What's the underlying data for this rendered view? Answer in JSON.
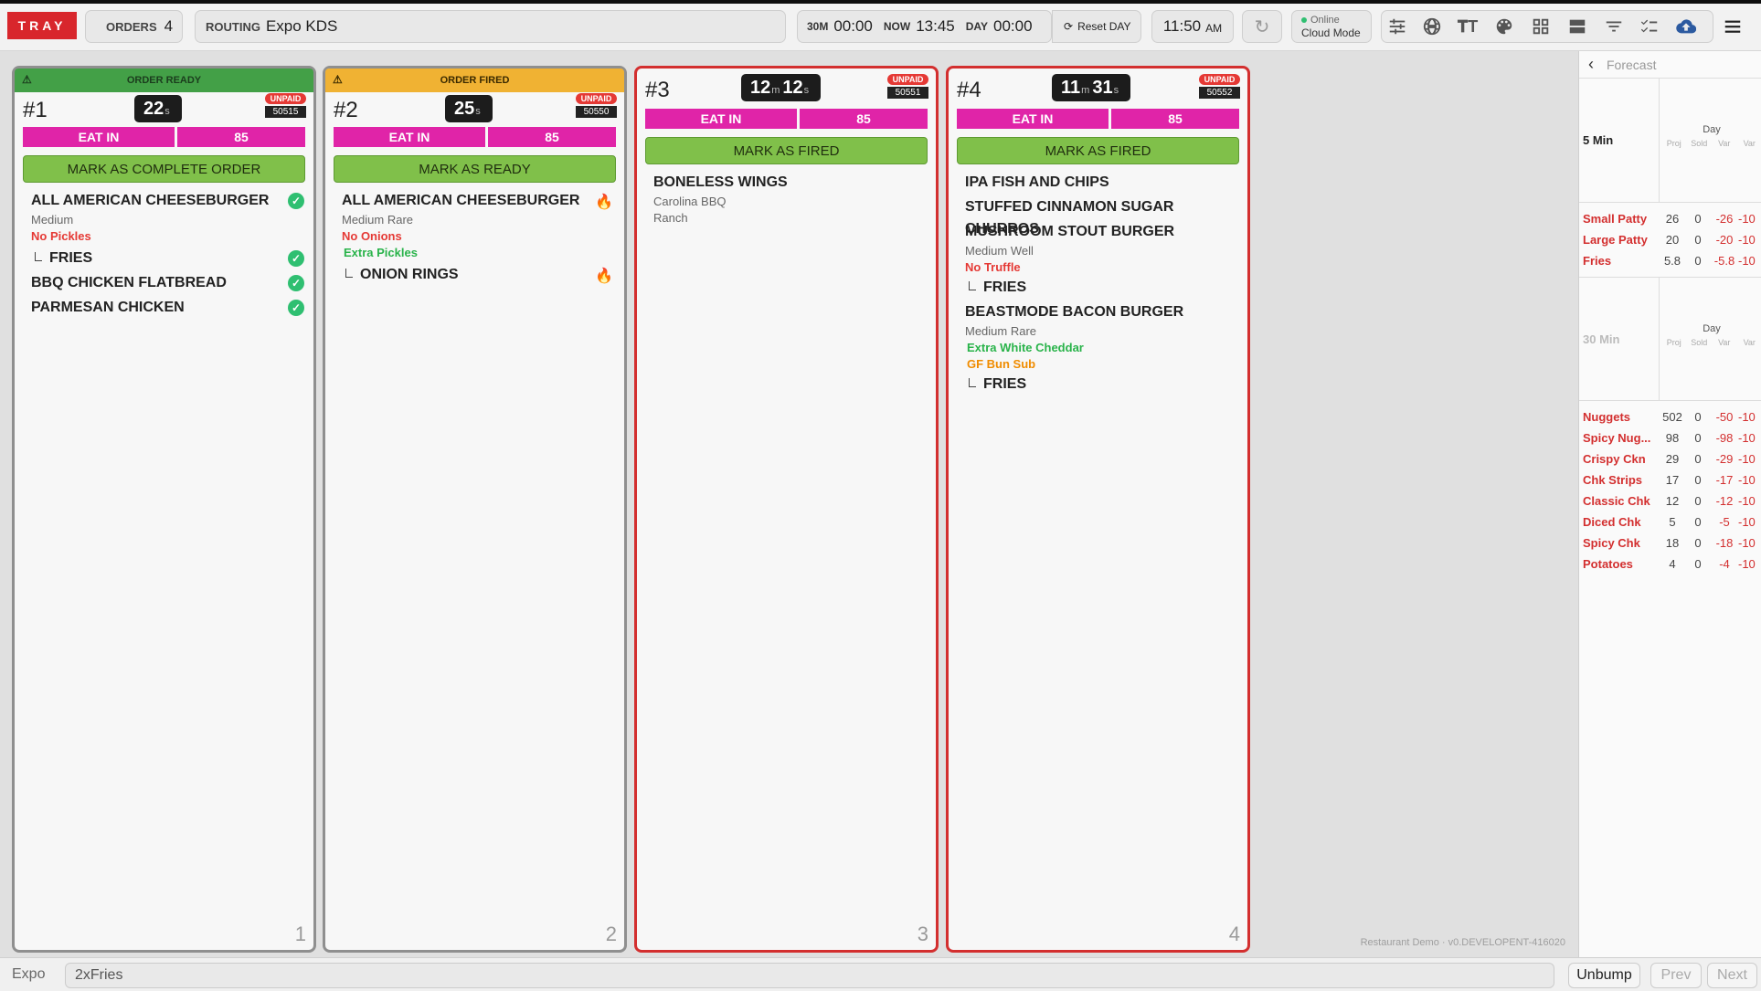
{
  "topbar": {
    "logo": "TRAY",
    "orders_label": "ORDERS",
    "orders_count": "4",
    "routing_label": "ROUTING",
    "routing_value": "Expo KDS",
    "t30_label": "30M",
    "t30_value": "00:00",
    "now_label": "NOW",
    "now_value": "13:45",
    "day_label": "DAY",
    "day_value": "00:00",
    "reset_label": "Reset DAY",
    "clock_time": "11:50",
    "clock_ampm": "AM",
    "status_online": "Online",
    "status_mode": "Cloud Mode"
  },
  "orders": [
    {
      "banner": "ORDER READY",
      "banner_color": "#43a047",
      "number": "#1",
      "timer_a": "22",
      "timer_a_unit": "s",
      "timer_b": "",
      "timer_b_unit": "",
      "unpaid": "UNPAID",
      "ticket": "50515",
      "type": "EAT IN",
      "table": "85",
      "action": "MARK AS COMPLETE ORDER",
      "col": "1"
    },
    {
      "banner": "ORDER FIRED",
      "banner_color": "#f0b233",
      "number": "#2",
      "timer_a": "25",
      "timer_a_unit": "s",
      "timer_b": "",
      "timer_b_unit": "",
      "unpaid": "UNPAID",
      "ticket": "50550",
      "type": "EAT IN",
      "table": "85",
      "action": "MARK AS READY",
      "col": "2"
    },
    {
      "number": "#3",
      "timer_a": "12",
      "timer_a_unit": "m",
      "timer_b": "12",
      "timer_b_unit": "s",
      "unpaid": "UNPAID",
      "ticket": "50551",
      "type": "EAT IN",
      "table": "85",
      "action": "MARK AS FIRED",
      "col": "3"
    },
    {
      "number": "#4",
      "timer_a": "11",
      "timer_a_unit": "m",
      "timer_b": "31",
      "timer_b_unit": "s",
      "unpaid": "UNPAID",
      "ticket": "50552",
      "type": "EAT IN",
      "table": "85",
      "action": "MARK AS FIRED",
      "col": "4"
    }
  ],
  "items1": {
    "i1": "ALL AMERICAN CHEESEBURGER",
    "i1m1": "Medium",
    "i1m2": "No Pickles",
    "i1s1": "FRIES",
    "i2": "BBQ CHICKEN FLATBREAD",
    "i3": "PARMESAN CHICKEN"
  },
  "items2": {
    "i1": "ALL AMERICAN CHEESEBURGER",
    "i1m1": "Medium Rare",
    "i1m2": "No Onions",
    "i1m3": "Extra Pickles",
    "i1s1": "ONION RINGS"
  },
  "items3": {
    "i1": "BONELESS WINGS",
    "i1m1": "Carolina BBQ",
    "i1m2": "Ranch"
  },
  "items4": {
    "i1": "IPA FISH AND CHIPS",
    "i2": "STUFFED CINNAMON SUGAR CHURROS",
    "i3": "MUSHROOM STOUT BURGER",
    "i3m1": "Medium Well",
    "i3m2": "No Truffle",
    "i3s1": "FRIES",
    "i4": "BEASTMODE BACON BURGER",
    "i4m1": "Medium Rare",
    "i4m2": "Extra White Cheddar",
    "i4m3": "GF Bun Sub",
    "i4s1": "FRIES"
  },
  "watermark": "Restaurant Demo · v0.DEVELOPENT-416020",
  "forecast": {
    "title": "Forecast",
    "sec1_label": "5 Min",
    "sec2_label": "30 Min",
    "day_label": "Day",
    "cols": [
      "Proj",
      "Sold",
      "Var",
      "Var"
    ],
    "rows1": [
      {
        "name": "Small Patty",
        "proj": "26",
        "sold": "0",
        "var": "-26",
        "pct": "-10"
      },
      {
        "name": "Large Patty",
        "proj": "20",
        "sold": "0",
        "var": "-20",
        "pct": "-10"
      },
      {
        "name": "Fries",
        "proj": "5.8",
        "sold": "0",
        "var": "-5.8",
        "pct": "-10"
      }
    ],
    "rows2": [
      {
        "name": "Nuggets",
        "proj": "502",
        "sold": "0",
        "var": "-50",
        "pct": "-10"
      },
      {
        "name": "Spicy Nug...",
        "proj": "98",
        "sold": "0",
        "var": "-98",
        "pct": "-10"
      },
      {
        "name": "Crispy Ckn",
        "proj": "29",
        "sold": "0",
        "var": "-29",
        "pct": "-10"
      },
      {
        "name": "Chk Strips",
        "proj": "17",
        "sold": "0",
        "var": "-17",
        "pct": "-10"
      },
      {
        "name": "Classic Chk",
        "proj": "12",
        "sold": "0",
        "var": "-12",
        "pct": "-10"
      },
      {
        "name": "Diced Chk",
        "proj": "5",
        "sold": "0",
        "var": "-5",
        "pct": "-10"
      },
      {
        "name": "Spicy Chk",
        "proj": "18",
        "sold": "0",
        "var": "-18",
        "pct": "-10"
      },
      {
        "name": "Potatoes",
        "proj": "4",
        "sold": "0",
        "var": "-4",
        "pct": "-10"
      }
    ]
  },
  "bottom": {
    "station": "Expo",
    "command": "2xFries",
    "unbump": "Unbump",
    "prev": "Prev",
    "next": "Next"
  }
}
